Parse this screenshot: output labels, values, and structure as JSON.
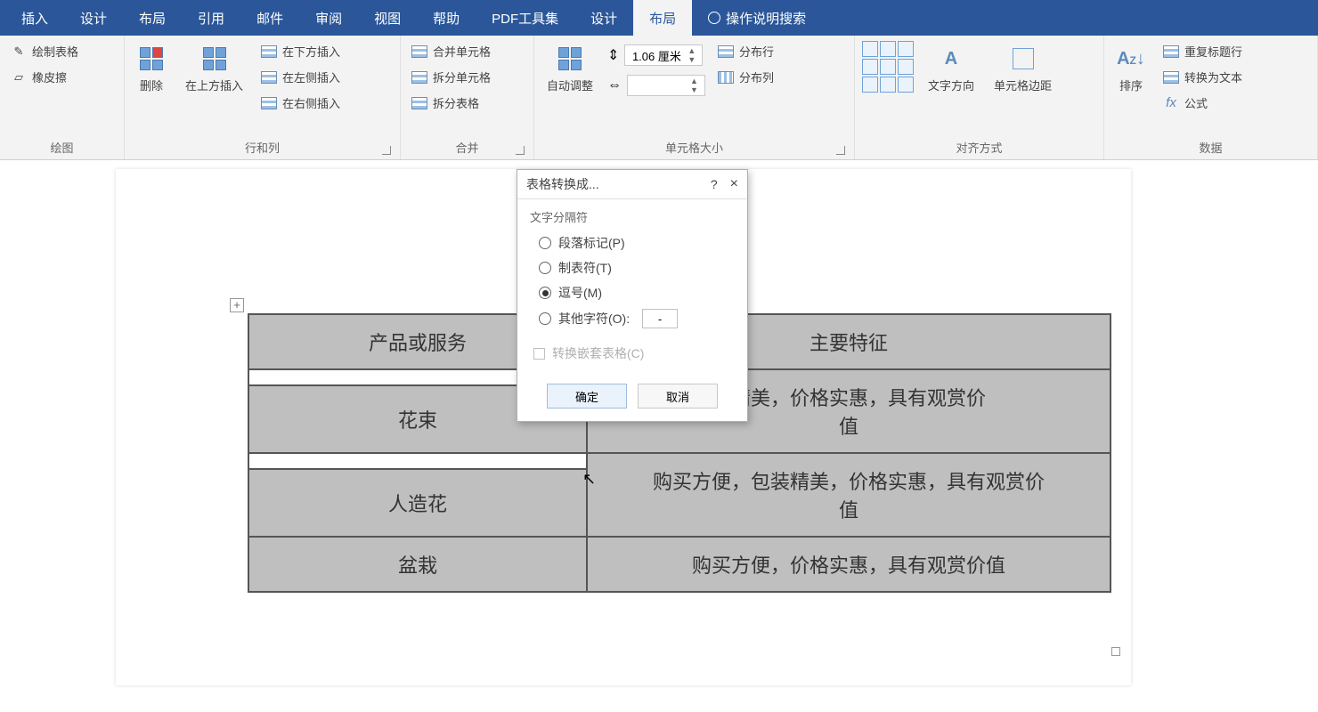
{
  "menu": {
    "tabs": [
      "插入",
      "设计",
      "布局",
      "引用",
      "邮件",
      "审阅",
      "视图",
      "帮助",
      "PDF工具集",
      "设计",
      "布局"
    ],
    "active_index": 10,
    "tell_me": "操作说明搜索"
  },
  "ribbon": {
    "draw": {
      "label": "绘图",
      "draw_table": "绘制表格",
      "eraser": "橡皮擦"
    },
    "rows_cols": {
      "label": "行和列",
      "delete": "删除",
      "insert_above": "在上方插入",
      "insert_below": "在下方插入",
      "insert_left": "在左侧插入",
      "insert_right": "在右侧插入"
    },
    "merge": {
      "label": "合并",
      "merge_cells": "合并单元格",
      "split_cells": "拆分单元格",
      "split_table": "拆分表格"
    },
    "cell_size": {
      "label": "单元格大小",
      "autofit": "自动调整",
      "height_value": "1.06 厘米",
      "dist_rows": "分布行",
      "dist_cols": "分布列"
    },
    "alignment": {
      "label": "对齐方式",
      "text_dir": "文字方向",
      "cell_margins": "单元格边距"
    },
    "data": {
      "label": "数据",
      "sort": "排序",
      "repeat_header": "重复标题行",
      "convert_text": "转换为文本",
      "formula": "公式"
    }
  },
  "document": {
    "anchor": "+",
    "table": {
      "header": [
        "产品或服务",
        "主要特征"
      ],
      "rows": [
        {
          "c1": "花束",
          "c2_prefix": "装精美，价格实惠，具有观赏价",
          "c2_suffix": "值"
        },
        {
          "c1": "人造花",
          "c2_line1": "购买方便，包装精美，价格实惠，具有观赏价",
          "c2_line2": "值"
        },
        {
          "c1": "盆栽",
          "c2": "购买方便，价格实惠，具有观赏价值"
        }
      ]
    }
  },
  "dialog": {
    "title": "表格转换成...",
    "help": "?",
    "close": "×",
    "section": "文字分隔符",
    "opt_paragraph": "段落标记(P)",
    "opt_tab": "制表符(T)",
    "opt_comma": "逗号(M)",
    "opt_other": "其他字符(O):",
    "other_value": "-",
    "selected": "comma",
    "nested": "转换嵌套表格(C)",
    "ok": "确定",
    "cancel": "取消"
  }
}
